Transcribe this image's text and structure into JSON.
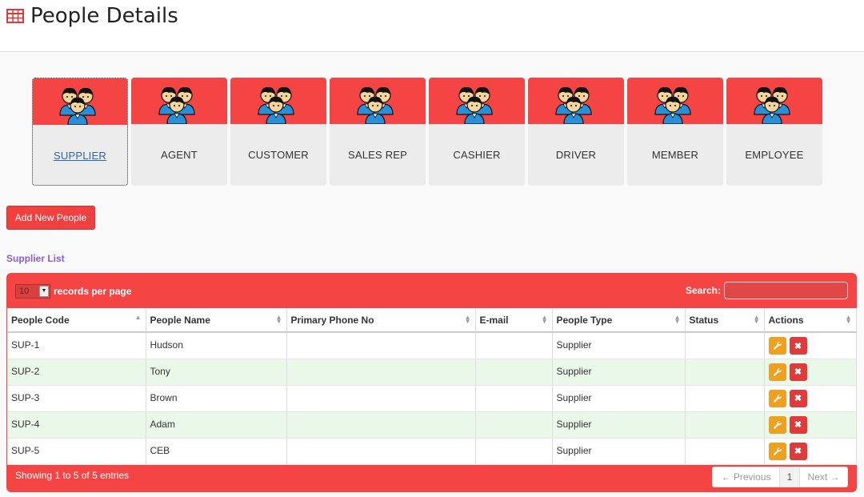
{
  "page": {
    "title": "People Details"
  },
  "tiles": [
    {
      "label": "SUPPLIER",
      "icon": "people-group-icon",
      "active": true
    },
    {
      "label": "AGENT",
      "icon": "people-group-icon"
    },
    {
      "label": "CUSTOMER",
      "icon": "people-group-icon"
    },
    {
      "label": "SALES REP",
      "icon": "people-group-icon"
    },
    {
      "label": "CASHIER",
      "icon": "people-group-icon"
    },
    {
      "label": "DRIVER",
      "icon": "people-group-icon"
    },
    {
      "label": "MEMBER",
      "icon": "people-group-icon"
    },
    {
      "label": "EMPLOYEE",
      "icon": "people-group-icon"
    }
  ],
  "add_button": "Add New People",
  "list_title": "Supplier List",
  "table_controls": {
    "page_length": "10",
    "length_label": "records per page",
    "search_label": "Search:",
    "search_value": ""
  },
  "columns": [
    "People Code",
    "People Name",
    "Primary Phone No",
    "E-mail",
    "People Type",
    "Status",
    "Actions"
  ],
  "rows": [
    {
      "code": "SUP-1",
      "name": "Hudson",
      "phone": "",
      "email": "",
      "type": "Supplier",
      "status": ""
    },
    {
      "code": "SUP-2",
      "name": "Tony",
      "phone": "",
      "email": "",
      "type": "Supplier",
      "status": ""
    },
    {
      "code": "SUP-3",
      "name": "Brown",
      "phone": "",
      "email": "",
      "type": "Supplier",
      "status": ""
    },
    {
      "code": "SUP-4",
      "name": "Adam",
      "phone": "",
      "email": "",
      "type": "Supplier",
      "status": ""
    },
    {
      "code": "SUP-5",
      "name": "CEB",
      "phone": "",
      "email": "",
      "type": "Supplier",
      "status": ""
    }
  ],
  "footer": {
    "info": "Showing 1 to 5 of 5 entries",
    "prev": "← Previous",
    "current": "1",
    "next": "Next →"
  },
  "colors": {
    "accent": "#f44444",
    "edit": "#f0a020",
    "delete": "#e03a3a",
    "alt_row": "#eaf8ea"
  }
}
